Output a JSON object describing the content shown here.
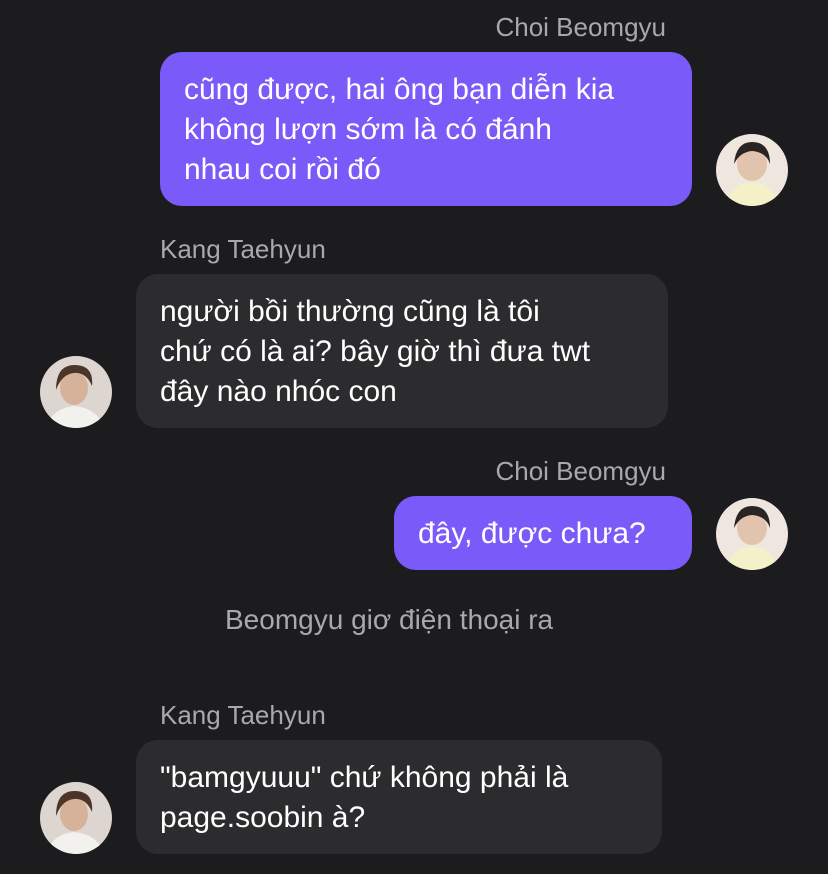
{
  "messages": [
    {
      "sender": "Choi Beomgyu",
      "direction": "outgoing",
      "lines": [
        "cũng được, hai ông bạn diễn kia",
        "không lượn sớm là có đánh",
        "nhau coi rồi đó"
      ]
    },
    {
      "sender": "Kang Taehyun",
      "direction": "incoming",
      "lines": [
        "người bồi thường cũng là tôi",
        "chứ có là ai? bây giờ thì đưa twt",
        "đây nào nhóc con"
      ]
    },
    {
      "sender": "Choi Beomgyu",
      "direction": "outgoing",
      "lines": [
        "đây, được chưa?"
      ]
    },
    {
      "system": "Beomgyu giơ điện thoại ra"
    },
    {
      "sender": "Kang Taehyun",
      "direction": "incoming",
      "lines": [
        "\"bamgyuuu\" chứ không phải là",
        "page.soobin à?"
      ]
    }
  ],
  "colors": {
    "background": "#1c1c1e",
    "outgoing_bubble": "#7a5af8",
    "incoming_bubble": "#2c2c2e",
    "meta_text": "#a8a8ad"
  },
  "icons": {
    "outgoing_avatar": "avatar-choi-beomgyu",
    "incoming_avatar": "avatar-kang-taehyun"
  }
}
